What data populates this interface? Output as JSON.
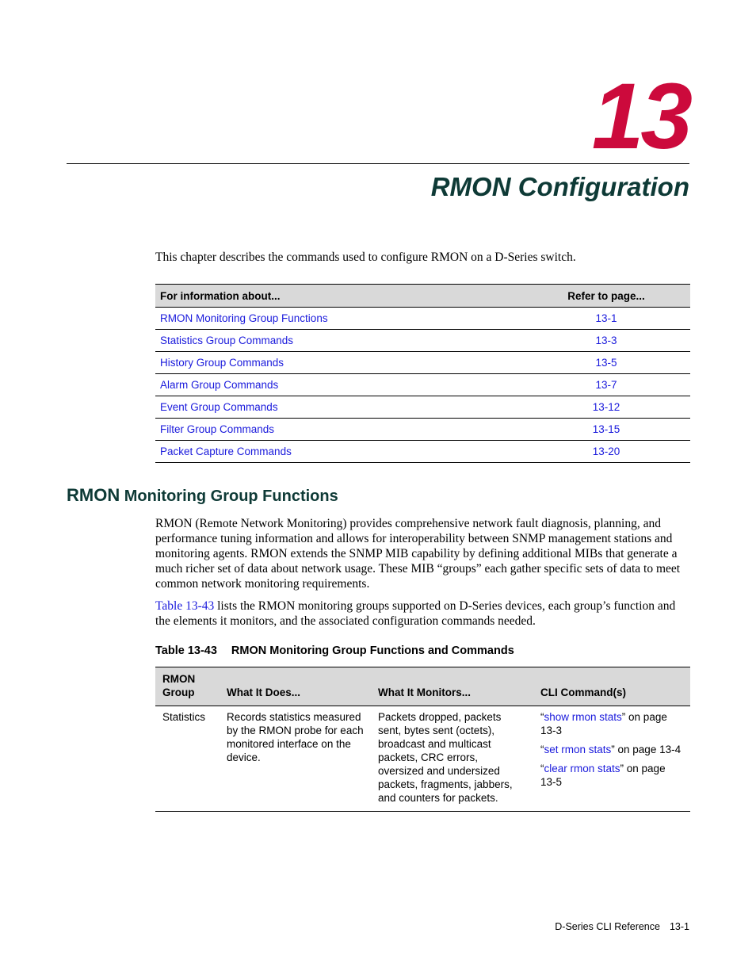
{
  "chapter": {
    "number": "13",
    "title": "RMON Configuration",
    "number_color": "#cc0a3c",
    "title_color": "#0e3a36"
  },
  "intro": "This chapter describes the commands used to configure RMON on a D-Series switch.",
  "toc": {
    "headers": [
      "For information about...",
      "Refer to page..."
    ],
    "rows": [
      {
        "topic": "RMON Monitoring Group Functions",
        "page": "13-1"
      },
      {
        "topic": "Statistics Group Commands",
        "page": "13-3"
      },
      {
        "topic": "History Group Commands",
        "page": "13-5"
      },
      {
        "topic": "Alarm Group Commands",
        "page": "13-7"
      },
      {
        "topic": "Event Group Commands",
        "page": "13-12"
      },
      {
        "topic": "Filter Group Commands",
        "page": "13-15"
      },
      {
        "topic": "Packet Capture Commands",
        "page": "13-20"
      }
    ]
  },
  "section": {
    "heading_prefix": "RMON",
    "heading_rest": " Monitoring Group Functions",
    "paragraph1": "RMON (Remote Network Monitoring) provides comprehensive network fault diagnosis, planning, and performance tuning information and allows for interoperability between SNMP management stations and monitoring agents. RMON extends the SNMP MIB capability by defining additional MIBs that generate a much richer set of data about network usage. These MIB “groups” each gather specific sets of data to meet common network monitoring requirements.",
    "paragraph2_link": "Table 13-43",
    "paragraph2_rest": " lists the RMON monitoring groups supported on D-Series devices, each group’s function and the elements it monitors, and the associated configuration commands needed."
  },
  "group_table": {
    "caption_label": "Table 13-43",
    "caption_title": "RMON Monitoring Group Functions and Commands",
    "headers": [
      "RMON Group",
      "What It Does...",
      "What It Monitors...",
      "CLI Command(s)"
    ],
    "rows": [
      {
        "group": "Statistics",
        "does": "Records statistics measured by the RMON probe for each monitored interface on the device.",
        "monitors": "Packets dropped, packets sent, bytes sent (octets), broadcast and multicast packets, CRC errors, oversized and undersized packets, fragments, jabbers, and counters for packets.",
        "commands": [
          {
            "open": "“",
            "link": "show rmon stats",
            "close": "” on page 13-3"
          },
          {
            "open": "“",
            "link": "set rmon stats",
            "close": "” on page 13-4"
          },
          {
            "open": "“",
            "link": "clear rmon stats",
            "close": "” on page 13-5"
          }
        ]
      }
    ]
  },
  "footer": {
    "doc_title": "D-Series CLI Reference",
    "page": "13-1"
  }
}
